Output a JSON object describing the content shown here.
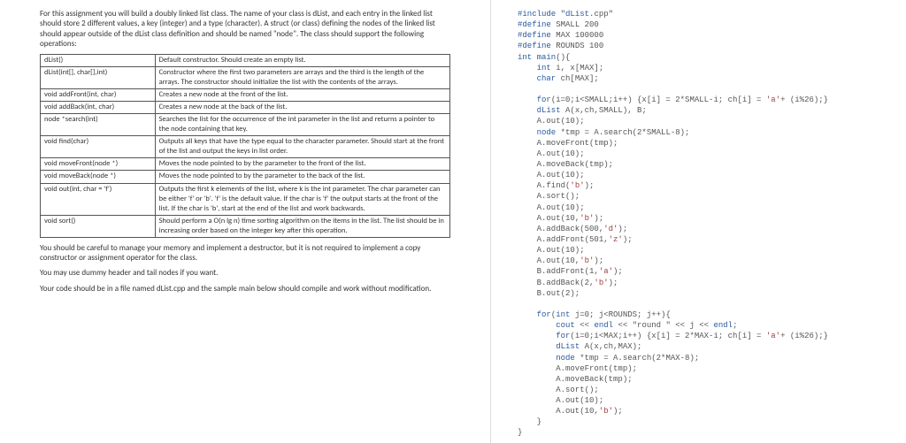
{
  "left": {
    "intro": "For this assignment you will build a doubly linked list class. The name of your class is dList, and each entry in the linked list should store 2 different values, a key (integer) and a type (character). A struct (or class) defining the nodes of the linked list should appear outside of the dList class definition and should be named \"node\". The class should support the following operations:",
    "ops": [
      {
        "sig": "dList()",
        "desc": "Default constructor. Should create an empty list."
      },
      {
        "sig": "dList(int[], char[],int)",
        "desc": "Constructor where the first two parameters are arrays and the third is the length of the arrays. The constructor should initialize the list with the contents of the arrays."
      },
      {
        "sig": "void addFront(int, char)",
        "desc": "Creates a new node at the front of the list."
      },
      {
        "sig": "void addBack(int, char)",
        "desc": "Creates a new node at the back of the list."
      },
      {
        "sig": "node *search(int)",
        "desc": "Searches the list for the occurrence of the int parameter in the list and returns a pointer to the node containing that key."
      },
      {
        "sig": "void  find(char)",
        "desc": "Outputs all keys that have the type equal to the character parameter. Should start at the front of the list and output the keys in list order."
      },
      {
        "sig": "void moveFront(node *)",
        "desc": "Moves the node pointed to by the parameter to the front of the list."
      },
      {
        "sig": "void moveBack(node *)",
        "desc": "Moves the node pointed to by the parameter to the back of the list."
      },
      {
        "sig": "void out(int, char = 'f')",
        "desc": "Outputs the first k elements of the list, where k is the int parameter. The char parameter can be either 'f' or 'b'. 'f' is the default value. If the char is 'f' the output starts at the front of the list. If the char is 'b', start at the end of the list and work backwards."
      },
      {
        "sig": "void sort()",
        "desc": "Should perform a O(n lg n) time sorting algorithm on the items in the list. The list should be in increasing order based on the integer key after this operation."
      }
    ],
    "careful": "You should be careful to manage your memory and implement a destructor, but it is not required to implement a copy constructor or assignment operator for the class.",
    "dummy": "You may use dummy header and tail nodes if you want.",
    "codefile": "Your code should be in a file named dList.cpp and the sample main below should compile and work without modification."
  },
  "code": "#include \"dList.cpp\"\n#define SMALL 200\n#define MAX 100000\n#define ROUNDS 100\nint main(){\n    int i, x[MAX];\n    char ch[MAX];\n\n    for(i=0;i<SMALL;i++) {x[i] = 2*SMALL-i; ch[i] = 'a'+ (i%26);}\n    dList A(x,ch,SMALL), B;\n    A.out(10);\n    node *tmp = A.search(2*SMALL-8);\n    A.moveFront(tmp);\n    A.out(10);\n    A.moveBack(tmp);\n    A.out(10);\n    A.find('b');\n    A.sort();\n    A.out(10);\n    A.out(10,'b');\n    A.addBack(500,'d');\n    A.addFront(501,'z');\n    A.out(10);\n    A.out(10,'b');\n    B.addFront(1,'a');\n    B.addBack(2,'b');\n    B.out(2);\n\n    for(int j=0; j<ROUNDS; j++){\n        cout << endl << \"round \" << j << endl;\n        for(i=0;i<MAX;i++) {x[i] = 2*MAX-i; ch[i] = 'a'+ (i%26);}\n        dList A(x,ch,MAX);\n        node *tmp = A.search(2*MAX-8);\n        A.moveFront(tmp);\n        A.moveBack(tmp);\n        A.sort();\n        A.out(10);\n        A.out(10,'b');\n    }\n}"
}
